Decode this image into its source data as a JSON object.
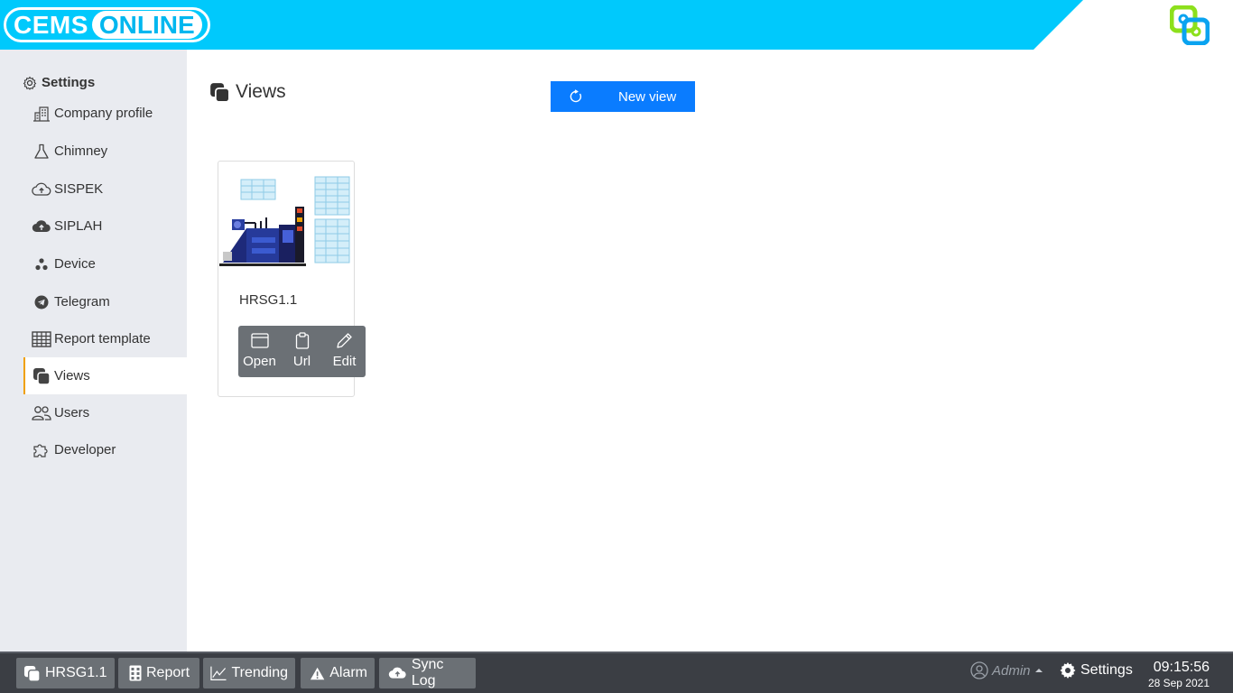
{
  "header": {
    "logo_part1": "CEMS",
    "logo_part2": "ONLINE"
  },
  "sidebar": {
    "title": "Settings",
    "items": [
      {
        "label": "Company profile",
        "icon": "building-icon"
      },
      {
        "label": "Chimney",
        "icon": "flask-icon"
      },
      {
        "label": "SISPEK",
        "icon": "cloud-upload-outline-icon"
      },
      {
        "label": "SIPLAH",
        "icon": "cloud-upload-icon"
      },
      {
        "label": "Device",
        "icon": "device-nodes-icon"
      },
      {
        "label": "Telegram",
        "icon": "telegram-icon"
      },
      {
        "label": "Report template",
        "icon": "table-icon"
      },
      {
        "label": "Views",
        "icon": "views-icon",
        "active": true
      },
      {
        "label": "Users",
        "icon": "users-icon"
      },
      {
        "label": "Developer",
        "icon": "puzzle-icon"
      }
    ]
  },
  "main": {
    "title": "Views",
    "new_view_label": "New view",
    "card": {
      "name": "HRSG1.1",
      "actions": [
        "Open",
        "Url",
        "Edit"
      ]
    }
  },
  "taskbar": {
    "buttons": [
      "HRSG1.1",
      "Report",
      "Trending",
      "Alarm",
      "Sync Log"
    ],
    "user": "Admin",
    "settings_label": "Settings",
    "time": "09:15:56",
    "date": "28 Sep 2021"
  },
  "colors": {
    "header_cyan": "#00c9fc",
    "primary_blue": "#0a7cff",
    "active_indicator": "#f0a000",
    "sidebar_bg": "#e9ebf0",
    "taskbar_bg": "#3b3e44",
    "button_gray": "#6b7075"
  }
}
